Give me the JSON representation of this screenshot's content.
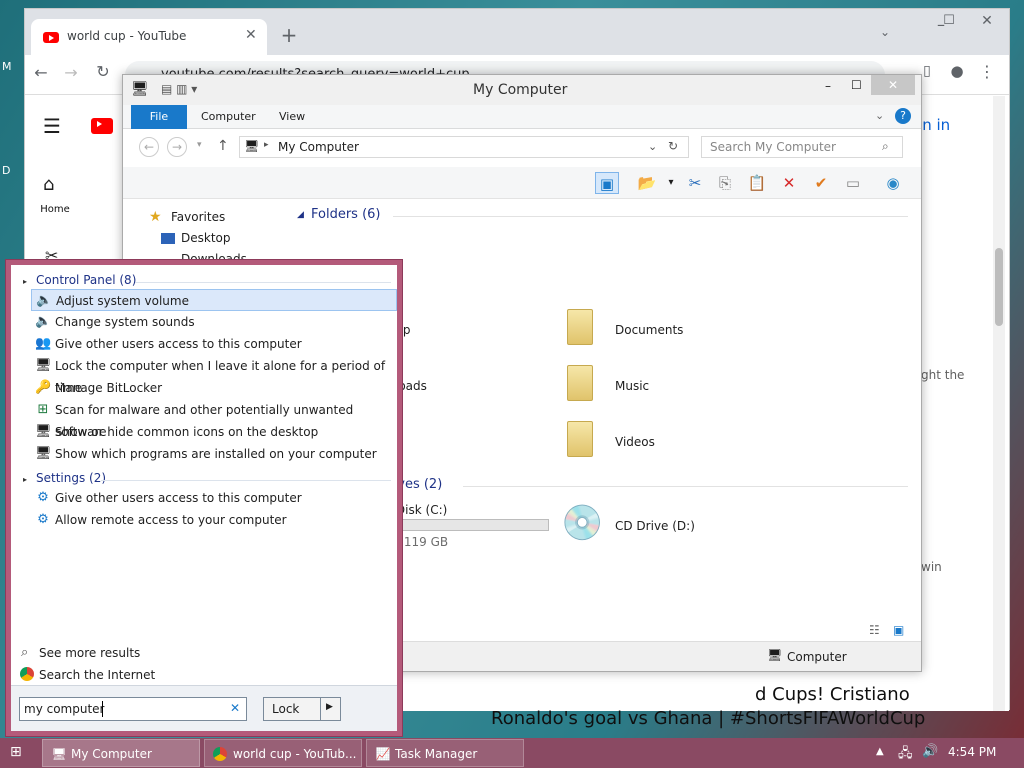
{
  "desktop": {
    "left_glyph_1": "M",
    "left_glyph_2": "D"
  },
  "chrome": {
    "tab_title": "world cup - YouTube",
    "url": "youtube.com/results?search_query=world+cup",
    "home_label": "Home",
    "sign_in": "Sign in",
    "result_fragment_1": "d Cups! Cristiano",
    "result_fragment_2": "Ronaldo's goal vs Ghana | #ShortsFIFAWorldCup",
    "side_text_1": "ght the",
    "side_text_2": "win"
  },
  "explorer": {
    "title": "My Computer",
    "ribbon": {
      "file": "File",
      "computer": "Computer",
      "view": "View"
    },
    "address": "My Computer",
    "search_placeholder": "Search My Computer",
    "nav": {
      "favorites": "Favorites",
      "desktop": "Desktop",
      "downloads": "Downloads"
    },
    "folders_header": "Folders (6)",
    "folders": [
      {
        "label": "Desktop"
      },
      {
        "label": "Documents"
      },
      {
        "label": "Downloads"
      },
      {
        "label": "Music"
      },
      {
        "label": "Videos"
      }
    ],
    "drives_header": "Hard Disk Drives (2)",
    "local_disk_label": "Local Disk (C:)",
    "local_disk_free": "free of 119 GB",
    "local_disk_used_fraction": 0.05,
    "cd_drive": "CD Drive (D:)",
    "status_computer": "Computer"
  },
  "start_menu": {
    "control_panel_header": "Control Panel (8)",
    "control_panel_items": [
      "Adjust system volume",
      "Change system sounds",
      "Give other users access to this computer",
      "Lock the computer when I leave it alone for a period of time",
      "Manage BitLocker",
      "Scan for malware and other potentially unwanted software",
      "Show or hide common icons on the desktop",
      "Show which programs are installed on your computer"
    ],
    "settings_header": "Settings (2)",
    "settings_items": [
      "Give other users access to this computer",
      "Allow remote access to your computer"
    ],
    "see_more": "See more results",
    "search_internet": "Search the Internet",
    "search_value": "my computer",
    "lock_label": "Lock"
  },
  "taskbar": {
    "items": [
      "My Computer",
      "world cup - YouTub...",
      "Task Manager"
    ],
    "clock": "4:54 PM"
  }
}
